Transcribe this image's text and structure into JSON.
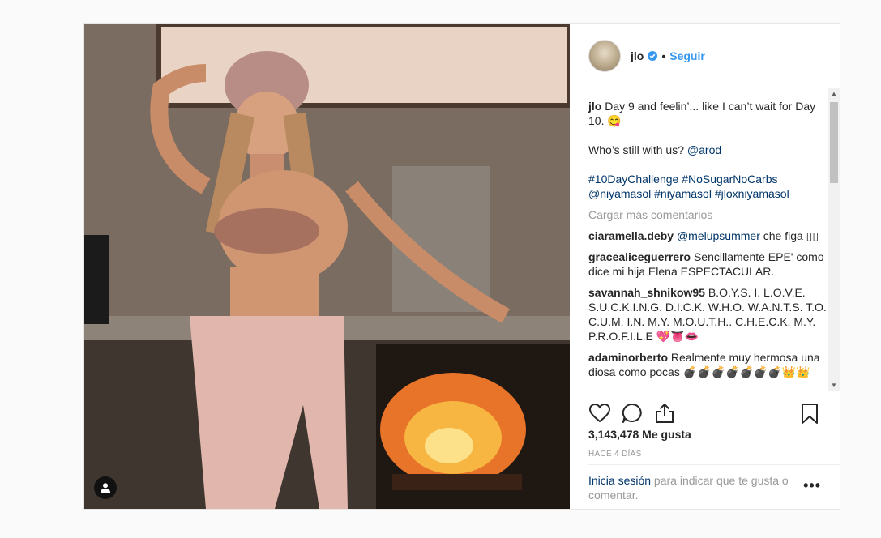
{
  "post": {
    "username": "jlo",
    "follow_label": "Seguir",
    "separator": "•",
    "caption_user": "jlo",
    "caption_line1": "Day 9 and feelin’... like I can’t wait for Day 10. 😋",
    "caption_line2_prefix": "Who’s still with us? ",
    "caption_mention": "@arod",
    "hashtags": [
      "#10DayChallenge",
      "#NoSugarNoCarbs",
      "@niyamasol",
      "#niyamasol",
      "#jloxniyamasol"
    ],
    "load_more_label": "Cargar más comentarios",
    "comments": [
      {
        "user": "ciaramella.deby",
        "mention": "@melupsummer",
        "text": " che figa ▯▯"
      },
      {
        "user": "gracealiceguerrero",
        "mention": "",
        "text": " Sencillamente EPE' como dice mi hija Elena ESPECTACULAR."
      },
      {
        "user": "savannah_shnikow95",
        "mention": "",
        "text": " B.O.Y.S. I. L.O.V.E. S.U.C.K.I.N.G. D.I.C.K. W.H.O. W.A.N.T.S. T.O. C.U.M. I.N. M.Y. M.O.U.T.H.. C.H.E.C.K. M.Y. P.R.O.F.I.L.E 💖👅👄"
      },
      {
        "user": "adaminorberto",
        "mention": "",
        "text": " Realmente muy hermosa una diosa como pocas 💣💣💣💣💣💣💣👑👑"
      }
    ],
    "likes": "3,143,478 Me gusta",
    "time_ago": "HACE 4 DÍAS",
    "login_link": "Inicia sesión",
    "login_text": " para indicar que te gusta o comentar.",
    "more_label": "•••"
  },
  "colors": {
    "link_blue": "#3897f0",
    "mention_blue": "#003569",
    "muted": "#999999"
  },
  "icons": [
    "verified-badge-icon",
    "heart-icon",
    "comment-icon",
    "share-icon",
    "bookmark-icon",
    "user-tag-icon",
    "more-options-icon"
  ]
}
